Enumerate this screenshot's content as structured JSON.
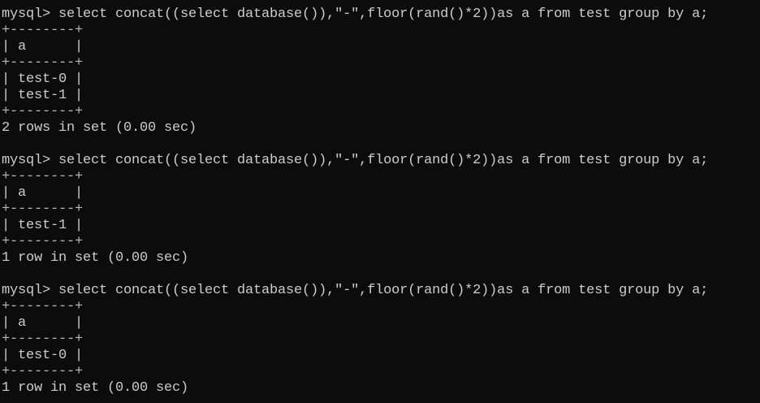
{
  "terminal": {
    "blocks": [
      {
        "command": "mysql> select concat((select database()),\"-\",floor(rand()*2))as a from test group by a;",
        "border_top": "+--------+",
        "header": "| a      |",
        "border_mid": "+--------+",
        "rows": [
          "| test-0 |",
          "| test-1 |"
        ],
        "border_bottom": "+--------+",
        "summary": "2 rows in set (0.00 sec)"
      },
      {
        "command": "mysql> select concat((select database()),\"-\",floor(rand()*2))as a from test group by a;",
        "border_top": "+--------+",
        "header": "| a      |",
        "border_mid": "+--------+",
        "rows": [
          "| test-1 |"
        ],
        "border_bottom": "+--------+",
        "summary": "1 row in set (0.00 sec)"
      },
      {
        "command": "mysql> select concat((select database()),\"-\",floor(rand()*2))as a from test group by a;",
        "border_top": "+--------+",
        "header": "| a      |",
        "border_mid": "+--------+",
        "rows": [
          "| test-0 |"
        ],
        "border_bottom": "+--------+",
        "summary": "1 row in set (0.00 sec)"
      }
    ]
  },
  "colors": {
    "background": "#0c0c0c",
    "text": "#cccccc"
  }
}
